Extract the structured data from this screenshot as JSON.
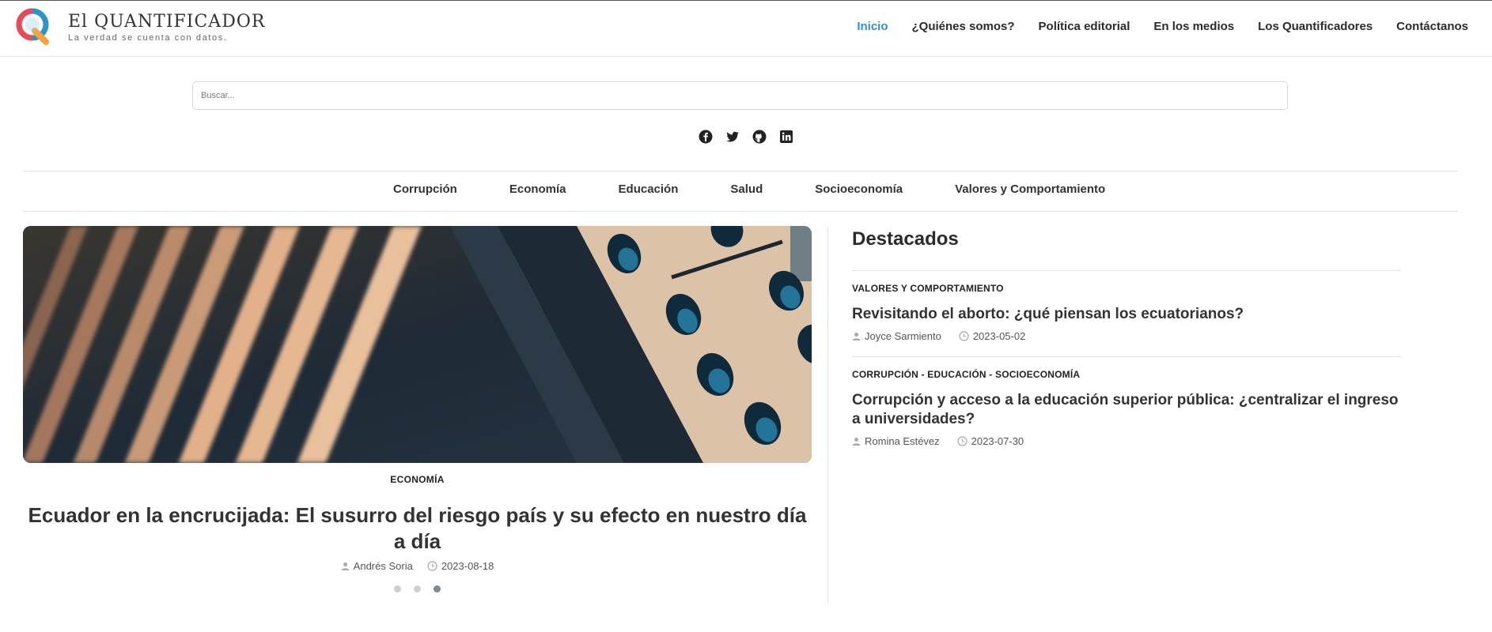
{
  "header": {
    "logo_name_first": "El",
    "logo_name_second": "Quantificador",
    "tagline": "La verdad se cuenta con datos."
  },
  "nav": {
    "items": [
      {
        "label": "Inicio",
        "active": true
      },
      {
        "label": "¿Quiénes somos?"
      },
      {
        "label": "Política editorial"
      },
      {
        "label": "En los medios"
      },
      {
        "label": "Los Quantificadores"
      },
      {
        "label": "Contáctanos"
      }
    ]
  },
  "search": {
    "placeholder": "Buscar..."
  },
  "social": {
    "icons": [
      "facebook-icon",
      "twitter-icon",
      "github-icon",
      "linkedin-icon"
    ]
  },
  "categories": [
    "Corrupción",
    "Economía",
    "Educación",
    "Salud",
    "Socioeconomía",
    "Valores y Comportamiento"
  ],
  "hero": {
    "category": "ECONOMÍA",
    "title": "Ecuador en la encrucijada: El susurro del riesgo país y su efecto en nuestro día a día",
    "author": "Andrés Soria",
    "date": "2023-08-18",
    "slides": 3,
    "active_slide": 3
  },
  "featured": {
    "heading": "Destacados",
    "articles": [
      {
        "category": "VALORES Y COMPORTAMIENTO",
        "title": "Revisitando el aborto: ¿qué piensan los ecuatorianos?",
        "author": "Joyce Sarmiento",
        "date": "2023-05-02"
      },
      {
        "category": "CORRUPCIÓN - EDUCACIÓN - SOCIOECONOMÍA",
        "title": "Corrupción y acceso a la educación superior pública: ¿centralizar el ingreso a universidades?",
        "author": "Romina Estévez",
        "date": "2023-07-30"
      }
    ]
  },
  "colors": {
    "accent": "#2e93c7",
    "text": "#333333",
    "border": "#e3e3e3"
  }
}
